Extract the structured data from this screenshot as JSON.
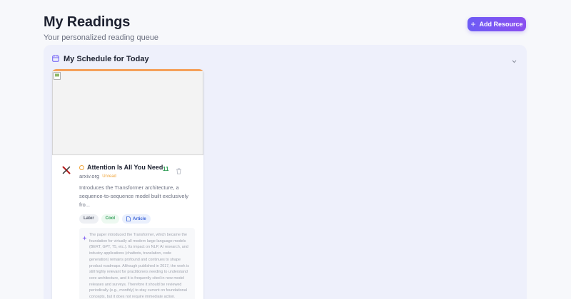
{
  "header": {
    "title": "My Readings",
    "subtitle": "Your personalized reading queue"
  },
  "toolbar": {
    "add_label": "Add Resource"
  },
  "schedule": {
    "title": "My Schedule for Today"
  },
  "card": {
    "title": "Attention Is All You Need",
    "source": "arxiv.org",
    "status": "Unread",
    "count": "11",
    "description": "Introduces the Transformer architecture, a sequence-to-sequence model built exclusively fro...",
    "tags": [
      "Later",
      "Cool",
      "Article"
    ],
    "note": "The paper introduced the Transformer, which became the foundation for virtually all modern large language models (BERT, GPT, T5, etc.). Its impact on NLP, AI research, and industry applications (chatbots, translation, code generation) remains profound and continues to shape product roadmaps. Although published in 2017, the work is still highly relevant for practitioners needing to understand core architecture, and it is frequently cited in new model releases and surveys. Therefore it should be reviewed periodically (e.g., monthly) to stay current on foundational concepts, but it does not require immediate action."
  },
  "colors": {
    "accent": "#6d5cf5",
    "card_accent": "#f5a05a",
    "unread": "#f0a53a",
    "count": "#2f9d55"
  },
  "icons": {
    "add": "plus-icon",
    "schedule": "calendar-icon",
    "collapse": "chevron-down-icon",
    "source": "arxiv-icon",
    "delete": "trash-icon",
    "type": "document-icon",
    "note": "sparkle-icon"
  }
}
